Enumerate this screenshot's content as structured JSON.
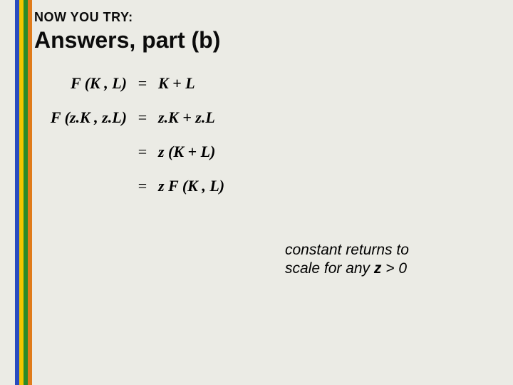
{
  "header": {
    "kicker": "NOW YOU TRY:",
    "title": "Answers, part (b)"
  },
  "math": {
    "rows": [
      {
        "lhs": "F (K , L)",
        "eq": "=",
        "rhs": "K + L"
      },
      {
        "lhs": "F (z.K , z.L)",
        "eq": "=",
        "rhs": "z.K + z.L"
      },
      {
        "lhs": "",
        "eq": "=",
        "rhs": "z (K + L)"
      },
      {
        "lhs": "",
        "eq": "=",
        "rhs": "z F (K , L)"
      }
    ]
  },
  "note": {
    "line1": "constant returns to",
    "line2_prefix": "scale for any ",
    "line2_z": "z",
    "line2_suffix": " > 0"
  },
  "stripes": [
    "blue",
    "yellow",
    "green",
    "orange"
  ]
}
